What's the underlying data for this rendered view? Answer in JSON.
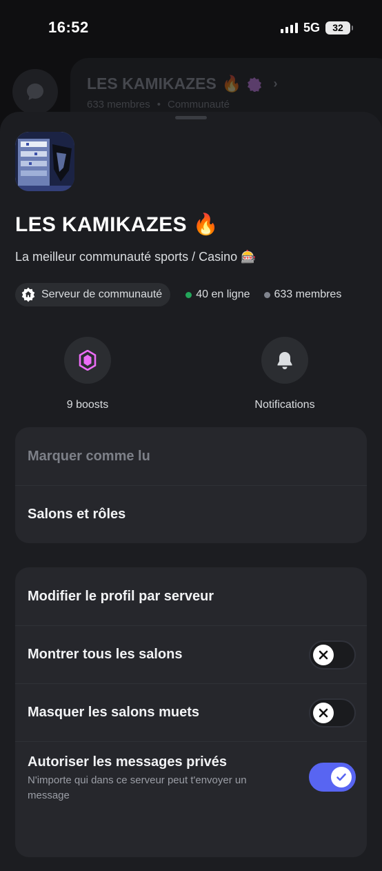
{
  "status_bar": {
    "time": "16:52",
    "network": "5G",
    "battery": "32"
  },
  "background": {
    "server_name": "LES KAMIKAZES",
    "server_emoji": "🔥",
    "members": "633 membres",
    "separator": "•",
    "category": "Communauté"
  },
  "server": {
    "title": "LES KAMIKAZES",
    "title_emoji": "🔥",
    "description": "La meilleur communauté sports / Casino",
    "description_emoji": "🎰",
    "community_label": "Serveur de communauté",
    "online": "40 en ligne",
    "members": "633 membres",
    "colors": {
      "online": "#23a55a",
      "members": "#80848e",
      "boost": "#eb6cf6",
      "accent": "#5865f2"
    }
  },
  "quick_actions": [
    {
      "label": "9 boosts",
      "icon": "boost-gem-icon"
    },
    {
      "label": "Notifications",
      "icon": "bell-icon"
    }
  ],
  "menu_group_1": [
    {
      "label": "Marquer comme lu",
      "disabled": true
    },
    {
      "label": "Salons et rôles"
    }
  ],
  "menu_group_2": [
    {
      "label": "Modifier le profil par serveur"
    },
    {
      "label": "Montrer tous les salons",
      "toggle": false
    },
    {
      "label": "Masquer les salons muets",
      "toggle": false
    },
    {
      "label": "Autoriser les messages privés",
      "sublabel": "N'importe qui dans ce serveur peut t'envoyer un message",
      "toggle": true
    }
  ]
}
